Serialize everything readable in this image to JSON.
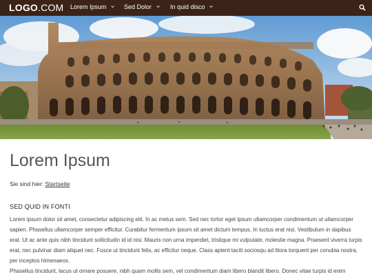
{
  "nav": {
    "logo_bold": "LOGO",
    "logo_light": ".COM",
    "items": [
      {
        "label": "Lorem Ipsum"
      },
      {
        "label": "Sed Dolor"
      },
      {
        "label": "In quid disco"
      }
    ],
    "search_icon": "search-icon"
  },
  "hero": {
    "image": "colosseum-photo"
  },
  "main": {
    "title": "Lorem Ipsum",
    "breadcrumb_prefix": "Sie sind hier:",
    "breadcrumb_link": "Startseite",
    "section_heading": "SED QUID IN FONTI",
    "paragraph1": "Lorem ipsum dolor sit amet, consectetur adipiscing elit. In ac metus sem. Sed nec tortor eget ipsum ullamcorper condimentum ut ullamcorper sapien. Phasellus ullamcorper semper efficitur. Curabitur fermentum ipsum sit amet dictum tempus. In luctus erat nisi. Vestibulum in dapibus erat. Ut ac ante quis nibh tincidunt sollicitudin id id nisi. Mauris non urna imperdiet, tristique mi vulputate, molestie magna. Praesent viverra turpis erat, nec pulvinar diam aliquet nec. Fusce ut tincidunt felis, ac efficitur neque. Class aptent taciti sociosqu ad litora torquent per conubia nostra, per inceptos himenaeos.",
    "paragraph2": "Phasellus tincidunt, lacus ut ornare posuere, nibh quam mollis sem, vel condimentum diam libero blandit libero. Donec vitae turpis id enim"
  }
}
